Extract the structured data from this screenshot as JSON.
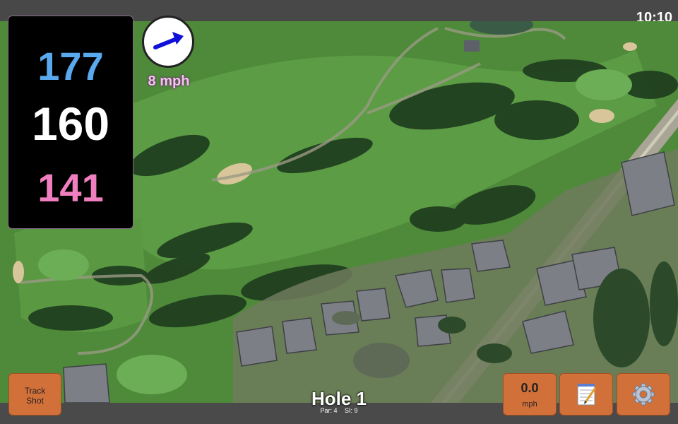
{
  "status": {
    "time": "10:10"
  },
  "distances": {
    "back": "177",
    "center": "160",
    "front": "141"
  },
  "wind": {
    "speed_label": "8 mph",
    "icon": "wind-arrow-icon"
  },
  "hole": {
    "title": "Hole 1",
    "par_label": "Par: 4",
    "si_label": "SI: 9"
  },
  "buttons": {
    "track_shot_line1": "Track",
    "track_shot_line2": "Shot",
    "wind_value": "0.0",
    "wind_unit": "mph",
    "notes_icon": "notepad-icon",
    "settings_icon": "gear-icon"
  },
  "colors": {
    "back_distance": "#5aa9ef",
    "center_distance": "#ffffff",
    "front_distance": "#f07fc0",
    "button": "#d2703a"
  }
}
